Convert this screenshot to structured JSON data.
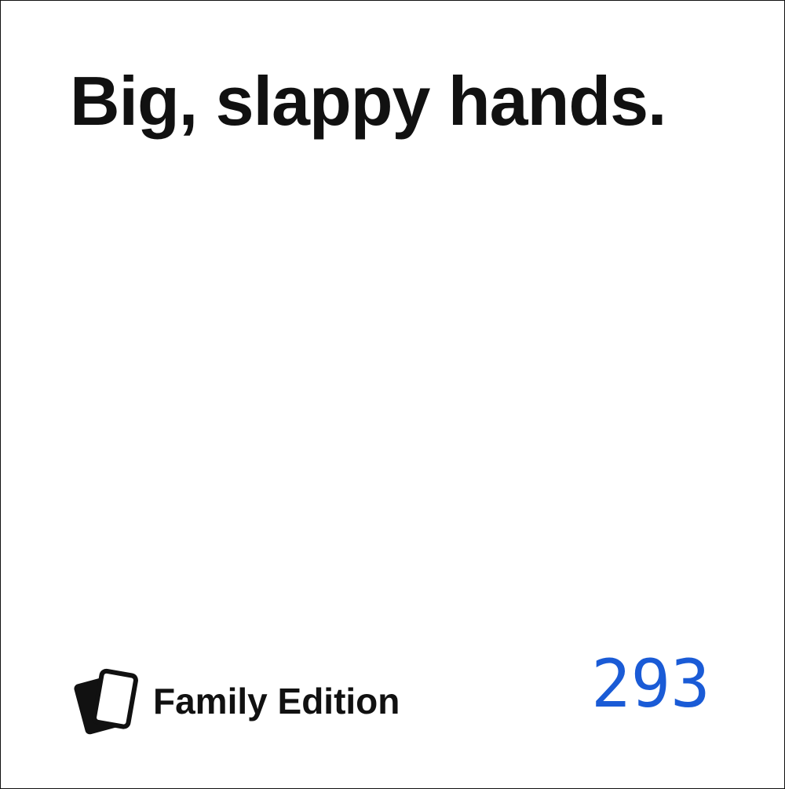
{
  "card": {
    "text": "Big, slappy hands.",
    "edition": "Family Edition",
    "number": "293",
    "logo_icon": "stacked-cards-icon",
    "colors": {
      "text": "#111111",
      "number": "#1a5bd6",
      "background": "#ffffff"
    }
  }
}
